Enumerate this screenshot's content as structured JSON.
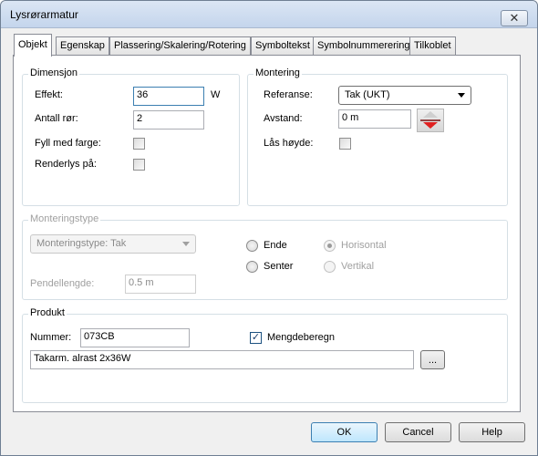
{
  "window": {
    "title": "Lysrørarmatur",
    "close_label": "✕"
  },
  "tabs": [
    {
      "label": "Objekt"
    },
    {
      "label": "Egenskap"
    },
    {
      "label": "Plassering/Skalering/Rotering"
    },
    {
      "label": "Symboltekst"
    },
    {
      "label": "Symbolnummerering"
    },
    {
      "label": "Tilkoblet"
    }
  ],
  "dimensjon": {
    "title": "Dimensjon",
    "effekt_label": "Effekt:",
    "effekt_value": "36",
    "effekt_unit": "W",
    "antall_label": "Antall rør:",
    "antall_value": "2",
    "fyll_label": "Fyll med farge:",
    "fyll_checked": false,
    "renderlys_label": "Renderlys på:",
    "renderlys_checked": false
  },
  "montering": {
    "title": "Montering",
    "referanse_label": "Referanse:",
    "referanse_value": "Tak (UKT)",
    "avstand_label": "Avstand:",
    "avstand_value": "0 m",
    "las_label": "Lås høyde:",
    "las_checked": false,
    "updown_icon": "up-down-arrow-icon",
    "arrow_color": "#e02020"
  },
  "monteringstype": {
    "title": "Monteringstype",
    "combo_value": "Monteringstype: Tak",
    "ende_label": "Ende",
    "senter_label": "Senter",
    "horisontal_label": "Horisontal",
    "vertikal_label": "Vertikal",
    "horisontal_selected": true,
    "pendel_label": "Pendellengde:",
    "pendel_value": "0.5 m"
  },
  "produkt": {
    "title": "Produkt",
    "nummer_label": "Nummer:",
    "nummer_value": "073CB",
    "mengde_label": "Mengdeberegn",
    "mengde_checked": true,
    "desc_value": "Takarm. alrast 2x36W",
    "browse_label": "..."
  },
  "buttons": {
    "ok": "OK",
    "cancel": "Cancel",
    "help": "Help"
  }
}
